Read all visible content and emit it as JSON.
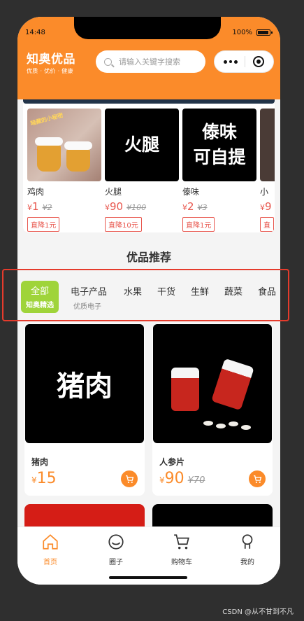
{
  "status": {
    "time": "14:48",
    "battery": "100%"
  },
  "header": {
    "brand_name": "知奥优品",
    "slogan": "优质 · 优价 · 健康",
    "search_placeholder": "请输入关键字搜索"
  },
  "deals": [
    {
      "name": "鸡肉",
      "price": "1",
      "old_price": "¥2",
      "badge": "直降1元",
      "image_text": "",
      "image_caption": "暗藏的小秘密"
    },
    {
      "name": "火腿",
      "price": "90",
      "old_price": "¥100",
      "badge": "直降10元",
      "image_text": "火腿"
    },
    {
      "name": "傣味",
      "price": "2",
      "old_price": "¥3",
      "badge": "直降1元",
      "image_text": "傣味\n可自提"
    },
    {
      "name": "小",
      "price": "9",
      "old_price": "",
      "badge": "直",
      "image_text": ""
    }
  ],
  "currency": "¥",
  "section_title": "优品推荐",
  "categories": {
    "active": {
      "label": "全部",
      "sub": "知奥精选"
    },
    "items": [
      "电子产品",
      "水果",
      "干货",
      "生鲜",
      "蔬菜",
      "食品"
    ],
    "second_sub": "优质电子"
  },
  "products": [
    {
      "name": "猪肉",
      "price": "15",
      "old_price": "",
      "image_text": "猪肉"
    },
    {
      "name": "人参片",
      "price": "90",
      "old_price": "¥70",
      "image_text": ""
    }
  ],
  "tabs": [
    {
      "label": "首页",
      "icon": "home-icon"
    },
    {
      "label": "圈子",
      "icon": "chat-icon"
    },
    {
      "label": "购物车",
      "icon": "cart-icon"
    },
    {
      "label": "我的",
      "icon": "user-icon"
    }
  ],
  "watermark": "CSDN @从不甘到不凡",
  "colors": {
    "accent": "#fb8b2a",
    "category_active": "#9fd43a",
    "price_red": "#e8564d",
    "highlight": "#e53b2c"
  }
}
